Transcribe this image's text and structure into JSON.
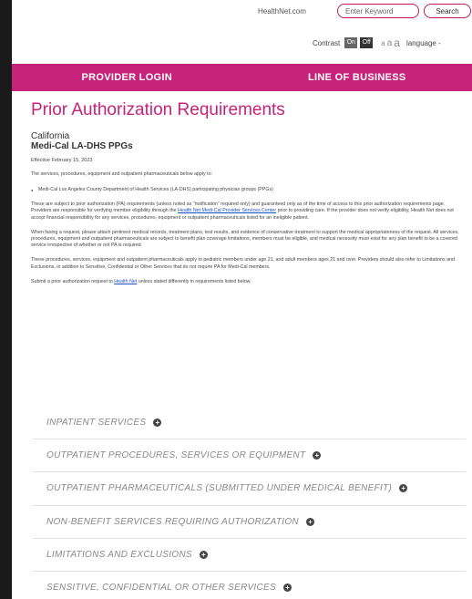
{
  "header": {
    "site_link": "HealthNet.com",
    "search_placeholder": "Enter Keyword",
    "search_button": "Search"
  },
  "accessibility": {
    "contrast_label": "Contrast",
    "on_label": "On",
    "off_label": "Off",
    "text_sizes": [
      "a",
      "a",
      "a"
    ],
    "language_label": "language -"
  },
  "nav": {
    "provider_login": "PROVIDER LOGIN",
    "line_of_business": "LINE OF BUSINESS"
  },
  "main": {
    "title": "Prior Authorization Requirements",
    "state": "California",
    "program": "Medi-Cal LA-DHS PPGs",
    "effective": "Effective February 15, 2023",
    "intro": "The services, procedures, equipment and outpatient pharmaceuticals below apply to:",
    "bullet": "Medi-Cal Los Angeles County Department of Health Services (LA-DHS) participating physician groups (PPGs)",
    "para1_a": "These are subject to prior authorization (PA) requirements (unless noted as \"notification\" required only) and guaranteed only as of the time of access to this prior authorization requirements page. Providers are responsible for verifying member eligibility through the ",
    "para1_link": "Health Net Medi-Cal Provider Services Center",
    "para1_b": " prior to providing care. If the provider does not verify eligibility, Health Net does not accept financial responsibility for any services, procedures, equipment or outpatient pharmaceuticals listed for an ineligible patient.",
    "para2": "When faxing a request, please attach pertinent medical records, treatment plans, test results, and evidence of conservative treatment to support the medical appropriateness of the request. All services, procedures, equipment and outpatient pharmaceuticals are subject to benefit plan coverage limitations, members must be eligible, and medical necessity must exist for any plan benefit to be a covered service irrespective of whether or not PA is required.",
    "para3": "These procedures, services, equipment and outpatient pharmaceuticals apply to pediatric members under age 21, and adult members ages 21 and over. Providers should also refer to Limitations and Exclusions, in addition to Sensitive, Confidential or Other Services that do not require PA for Medi-Cal members.",
    "para4_a": "Submit a prior authorization request to ",
    "para4_link": "Health Net",
    "para4_b": " unless stated differently in requirements listed below."
  },
  "accordion": [
    {
      "label": "INPATIENT SERVICES"
    },
    {
      "label": "OUTPATIENT PROCEDURES, SERVICES OR EQUIPMENT"
    },
    {
      "label": "OUTPATIENT PHARMACEUTICALS (SUBMITTED UNDER MEDICAL BENEFIT)"
    },
    {
      "label": "NON-BENEFIT SERVICES REQUIRING AUTHORIZATION"
    },
    {
      "label": "LIMITATIONS AND EXCLUSIONS"
    },
    {
      "label": "SENSITIVE, CONFIDENTIAL OR OTHER SERVICES"
    }
  ],
  "icons": {
    "expand": "plus-circle-icon",
    "expand_glyph": "+"
  },
  "colors": {
    "brand": "#c7237a",
    "link": "#1a4fc4"
  }
}
